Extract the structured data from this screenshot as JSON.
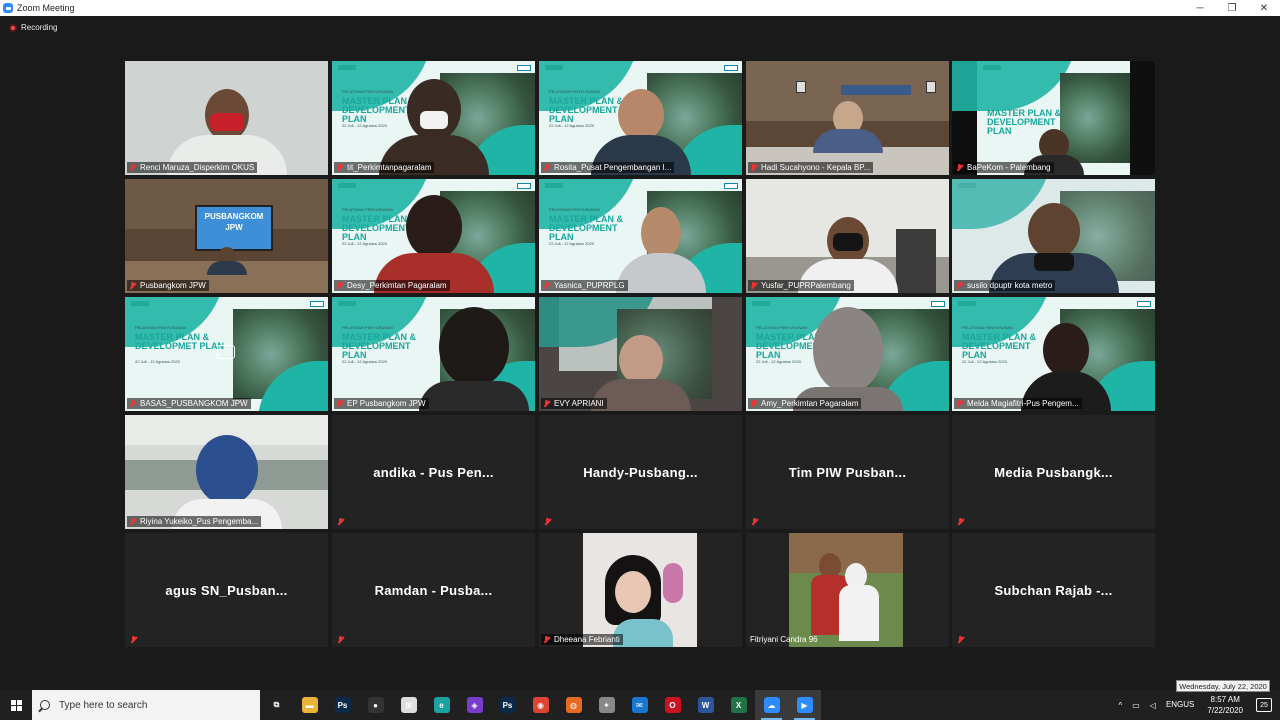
{
  "window": {
    "title": "Zoom Meeting",
    "minimize": "─",
    "maximize": "❐",
    "close": "✕"
  },
  "meeting": {
    "recording_label": "Recording",
    "participants": [
      {
        "name": "Renci Maruza_Disperkim OKUS"
      },
      {
        "name": "tit_Perkimtanpagaralam"
      },
      {
        "name": "Rosita_Pusat Pengembangan I..."
      },
      {
        "name": "Hadi Sucahyono - Kepala BP..."
      },
      {
        "name": "BaPeKom - Palembang"
      },
      {
        "name": "Pusbangkom JPW"
      },
      {
        "name": "Desy_Perkimtan Pagaralam"
      },
      {
        "name": "Yasnica_PUPRPLG"
      },
      {
        "name": "Yusfar_PUPRPalembang"
      },
      {
        "name": "susilo dpuptr kota metro"
      },
      {
        "name": "BASAS_PUSBANGKOM JPW"
      },
      {
        "name": "EP Pusbangkom JPW"
      },
      {
        "name": "EVY APRIANI"
      },
      {
        "name": "Amy_Perkimtan Pagaralam"
      },
      {
        "name": "Melda Magiafitri-Pus Pengem..."
      },
      {
        "name": "Riyina Yukeiko_Pus Pengemba..."
      },
      {
        "name": "andika - Pus Pen..."
      },
      {
        "name": "Handy-Pusbang..."
      },
      {
        "name": "Tim PIW Pusban..."
      },
      {
        "name": "Media Pusbangk..."
      },
      {
        "name": "agus SN_Pusban..."
      },
      {
        "name": "Ramdan - Pusba..."
      },
      {
        "name": "Dheeana Febrianti"
      },
      {
        "name": "Fitriyani Candra 96"
      },
      {
        "name": "Subchan Rajab -..."
      }
    ],
    "slide": {
      "subtitle": "PELATIHAN PENYUSUNAN",
      "title_a": "MASTER PLAN & DEVELOPMENT PLAN",
      "title_b": "MASTER PLAN & DEVELOPMET PLAN",
      "dates": "22 Juli - 12 Agustus 2020",
      "banner_title": "PUSBANGKOM JPW"
    }
  },
  "taskbar": {
    "search_placeholder": "Type here to search",
    "apps": [
      {
        "name": "task-view",
        "glyph": "⧉",
        "color": "#202020"
      },
      {
        "name": "file-explorer",
        "glyph": "▬",
        "color": "#e8b339"
      },
      {
        "name": "photoshop",
        "glyph": "Ps",
        "color": "#0b2a4a"
      },
      {
        "name": "obs",
        "glyph": "●",
        "color": "#333333"
      },
      {
        "name": "store",
        "glyph": "⊞",
        "color": "#dddddd"
      },
      {
        "name": "edge",
        "glyph": "e",
        "color": "#1ba1a1"
      },
      {
        "name": "app-colorful",
        "glyph": "◈",
        "color": "#7a3ccc"
      },
      {
        "name": "photoshop-2",
        "glyph": "Ps",
        "color": "#0b2a4a"
      },
      {
        "name": "chrome",
        "glyph": "◉",
        "color": "#dd4433"
      },
      {
        "name": "firefox",
        "glyph": "◍",
        "color": "#e66a1f"
      },
      {
        "name": "app-bird",
        "glyph": "✦",
        "color": "#888888"
      },
      {
        "name": "mail",
        "glyph": "✉",
        "color": "#1877d0"
      },
      {
        "name": "opera",
        "glyph": "O",
        "color": "#cc1122"
      },
      {
        "name": "word",
        "glyph": "W",
        "color": "#2b579a"
      },
      {
        "name": "excel",
        "glyph": "X",
        "color": "#217346"
      },
      {
        "name": "cloud-app",
        "glyph": "☁",
        "color": "#2d8cff"
      },
      {
        "name": "zoom",
        "glyph": "▶",
        "color": "#2d8cff"
      }
    ],
    "tray": {
      "up_arrow": "^",
      "lang_top": "ENG",
      "lang_bottom": "US",
      "time": "8:57 AM",
      "date": "7/22/2020",
      "notifications": "25"
    },
    "date_tooltip": "Wednesday, July 22, 2020"
  }
}
